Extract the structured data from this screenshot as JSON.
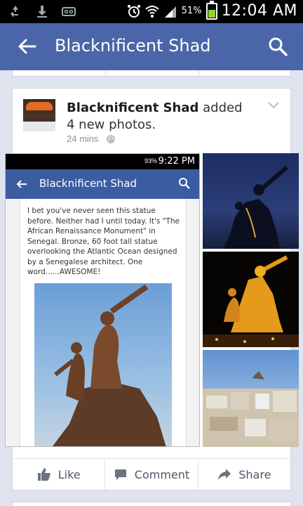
{
  "status_bar": {
    "battery_percent_text": "51%",
    "time": "12:04 AM",
    "icons": [
      "recycle-icon",
      "download-icon",
      "voicemail-icon",
      "alarm-icon",
      "wifi-icon",
      "signal-icon",
      "battery-icon"
    ]
  },
  "app_bar": {
    "title": "Blacknificent Shad",
    "back_icon": "back-arrow-icon",
    "search_icon": "search-icon",
    "color": "#4a66a8"
  },
  "post": {
    "author": "Blacknificent Shad",
    "action": " added 4 new photos.",
    "time": "24 mins",
    "privacy_icon": "globe-icon",
    "menu_icon": "chevron-down-icon",
    "photos": {
      "main_screenshot": {
        "status_percent": "93%",
        "status_time": "9:22 PM",
        "title": "Blacknificent Shad",
        "text": "I bet you've never seen this statue before. Neither had I until today. It's \"The African Renaissance Monument\" in Senegal. Bronze, 60 foot tall statue overlooking the Atlantic Ocean designed by a Senegalese architect. One word......AWESOME!"
      }
    }
  },
  "actions": {
    "like": "Like",
    "comment": "Comment",
    "share": "Share"
  }
}
